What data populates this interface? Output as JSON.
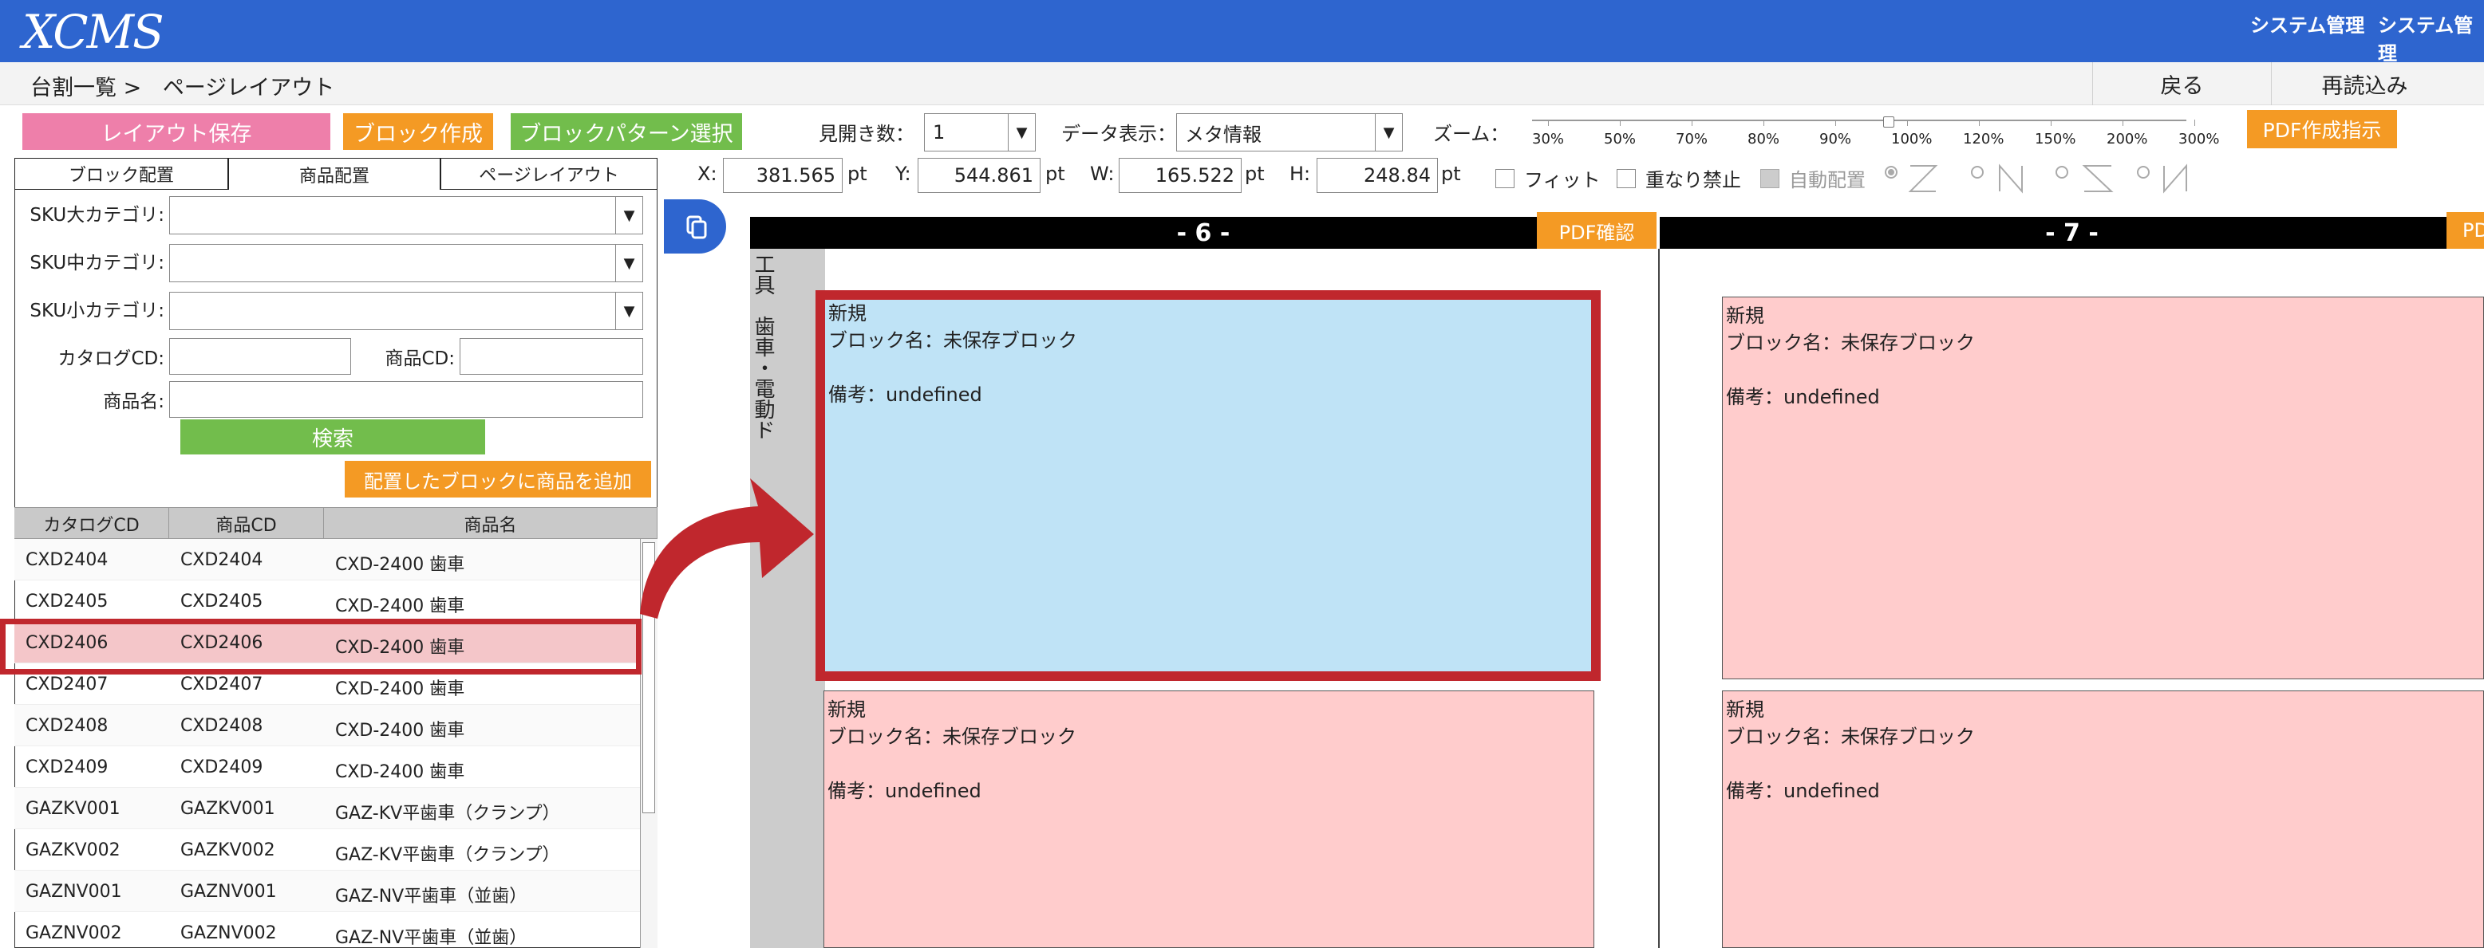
{
  "header": {
    "logo": "XCMS",
    "menu1": "システム管理",
    "menu2": "システム管理"
  },
  "nav": {
    "breadcrumb_parent": "台割一覧 >",
    "breadcrumb_current": "ページレイアウト",
    "back": "戻る",
    "reload": "再読込み"
  },
  "toolbar": {
    "save_layout": "レイアウト保存",
    "create_block": "ブロック作成",
    "block_pattern": "ブロックパターン選択",
    "spread_label": "見開き数：",
    "spread_value": "1",
    "data_display_label": "データ表示：",
    "data_display_value": "メタ情報",
    "zoom_label": "ズーム：",
    "zoom_ticks": [
      "30%",
      "50%",
      "70%",
      "80%",
      "90%",
      "100%",
      "120%",
      "150%",
      "200%",
      "300%"
    ],
    "zoom_value": "100%",
    "pdf_instruction": "PDF作成指示",
    "x_label": "X:",
    "x_value": "381.565",
    "y_label": "Y:",
    "y_value": "544.861",
    "w_label": "W:",
    "w_value": "165.522",
    "h_label": "H:",
    "h_value": "248.84",
    "unit": "pt",
    "fit": "フィット",
    "no_overlap": "重なり禁止",
    "auto_place": "自動配置"
  },
  "tabs": [
    "ブロック配置",
    "商品配置",
    "ページレイアウト"
  ],
  "filters": {
    "sku_large": "SKU大カテゴリ:",
    "sku_mid": "SKU中カテゴリ:",
    "sku_small": "SKU小カテゴリ:",
    "catalog_cd": "カタログCD:",
    "product_cd": "商品CD:",
    "product_name": "商品名:",
    "search": "検索",
    "add_to_block": "配置したブロックに商品を追加"
  },
  "table": {
    "headers": [
      "カタログCD",
      "商品CD",
      "商品名"
    ],
    "rows": [
      [
        "CXD2404",
        "CXD2404",
        "CXD-2400 歯車"
      ],
      [
        "CXD2405",
        "CXD2405",
        "CXD-2400 歯車"
      ],
      [
        "CXD2406",
        "CXD2406",
        "CXD-2400 歯車"
      ],
      [
        "CXD2407",
        "CXD2407",
        "CXD-2400 歯車"
      ],
      [
        "CXD2408",
        "CXD2408",
        "CXD-2400 歯車"
      ],
      [
        "CXD2409",
        "CXD2409",
        "CXD-2400 歯車"
      ],
      [
        "GAZKV001",
        "GAZKV001",
        "GAZ-KV平歯車（クランプ）"
      ],
      [
        "GAZKV002",
        "GAZKV002",
        "GAZ-KV平歯車（クランプ）"
      ],
      [
        "GAZNV001",
        "GAZNV001",
        "GAZ-NV平歯車（並歯）"
      ],
      [
        "GAZNV002",
        "GAZNV002",
        "GAZ-NV平歯車（並歯）"
      ]
    ],
    "selected_index": 2
  },
  "pages": {
    "page6": "- 6 -",
    "page7": "- 7 -",
    "pdf_check": "PDF確認",
    "pdf_check_partial": "PD",
    "side_label": "工具　歯車・電動ド"
  },
  "blocks": {
    "status": "新規",
    "name": "ブロック名：未保存ブロック",
    "note": "備考：undefined"
  },
  "colors": {
    "header_bg": "#2e65cf",
    "highlight": "#c0272d",
    "block_pink": "#ffcccc",
    "block_blue": "#bfe3f6",
    "orange": "#f49a24",
    "green": "#72bd4c",
    "pink": "#ee7faa"
  }
}
